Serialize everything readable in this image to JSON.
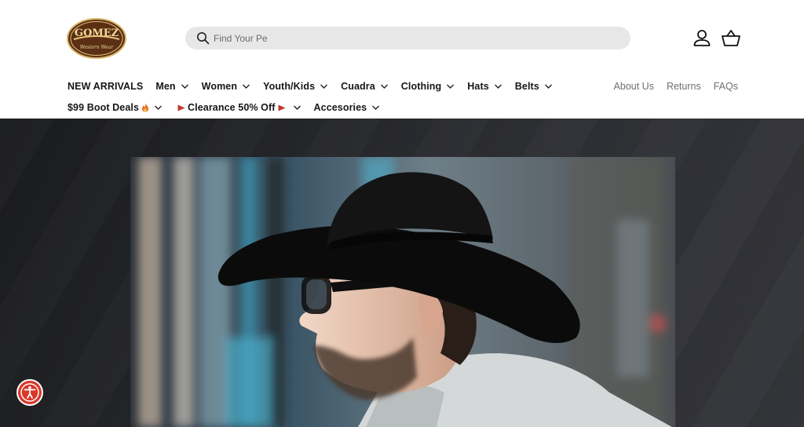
{
  "brand": {
    "logo_text": "GOMEZ",
    "logo_subtext": "Western Wear"
  },
  "search": {
    "placeholder": "Find Your Pe"
  },
  "header_icons": {
    "account": "account-icon",
    "cart": "basket-icon"
  },
  "nav": {
    "primary": [
      {
        "label": "NEW ARRIVALS",
        "dropdown": false
      },
      {
        "label": "Men",
        "dropdown": true
      },
      {
        "label": "Women",
        "dropdown": true
      },
      {
        "label": "Youth/Kids",
        "dropdown": true
      },
      {
        "label": "Cuadra",
        "dropdown": true
      },
      {
        "label": "Clothing",
        "dropdown": true
      },
      {
        "label": "Hats",
        "dropdown": true
      },
      {
        "label": "Belts",
        "dropdown": true
      }
    ],
    "secondary_row": [
      {
        "label": "$99 Boot Deals",
        "icon": "fire-icon",
        "dropdown": true
      },
      {
        "label": "Clearance 50% Off",
        "icon": "flag-icon",
        "dropdown": true
      },
      {
        "label": "Accesories",
        "dropdown": true
      }
    ],
    "utility": [
      {
        "label": "About Us"
      },
      {
        "label": "Returns"
      },
      {
        "label": "FAQs"
      }
    ]
  },
  "hero": {
    "image": "man-in-black-cowboy-hat-photo"
  },
  "accessibility": {
    "icon": "accessibility-icon"
  },
  "colors": {
    "header_bg": "#ffffff",
    "search_bg": "#e7e7e7",
    "hero_bg": "#2b2c30",
    "logo_brown": "#5a2f14",
    "logo_gold": "#e4c27a",
    "a11y_red": "#d9372b",
    "flag_red": "#c0392b"
  }
}
